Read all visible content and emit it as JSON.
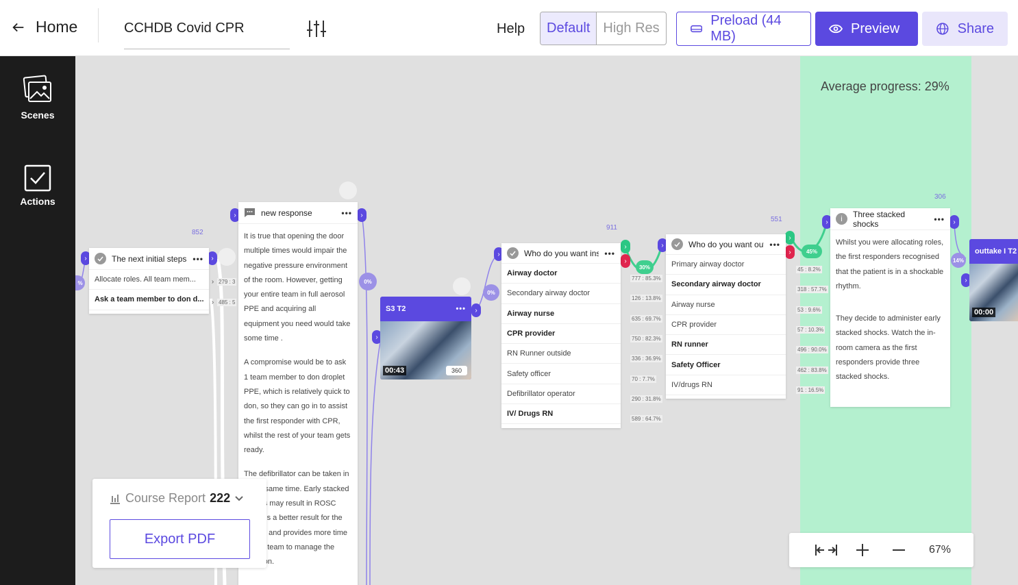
{
  "header": {
    "home_label": "Home",
    "project_title": "CCHDB Covid CPR",
    "help_label": "Help",
    "resolution": {
      "default_label": "Default",
      "high_label": "High Res",
      "selected": "Default"
    },
    "preload_label": "Preload (44 MB)",
    "preview_label": "Preview",
    "share_label": "Share"
  },
  "sidebar": {
    "items": [
      {
        "label": "Scenes",
        "icon": "images-icon"
      },
      {
        "label": "Actions",
        "icon": "checkbox-icon"
      }
    ]
  },
  "canvas": {
    "average_progress": "Average progress: 29%",
    "nodes": {
      "next_steps": {
        "title": "The next initial steps",
        "count": "852",
        "options": [
          "Allocate roles. All team mem...",
          "Ask a team member to don d..."
        ],
        "stats": [
          "279 : 3",
          "485 : 5"
        ],
        "in_pct": "%"
      },
      "new_response": {
        "title": "new response",
        "paragraphs": [
          "It is true that opening the door multiple times would impair the negative pressure environment of the room. However, getting your entire team in full aerosol PPE and acquiring all equipment you need would take some time .",
          "A compromise would be to ask 1 team member to don droplet PPE, which is relatively quick to don, so they can go in to assist the first responder with CPR, whilst the rest of your team gets ready.",
          "The defibrillator can be taken in at the same time. Early stacked shocks may result in ROSC which is a better result for the patient and provides more time for the team to manage the situation."
        ],
        "out_pct": "0%"
      },
      "s3t2": {
        "title": "S3 T2",
        "time": "00:43",
        "badge": "360",
        "in_pct": "0%"
      },
      "inside": {
        "title": "Who do you want inside?",
        "count": "911",
        "options": [
          {
            "label": "Airway doctor",
            "bold": true,
            "stat": "777 : 85.3%"
          },
          {
            "label": "Secondary airway doctor",
            "bold": false,
            "stat": "126 : 13.8%"
          },
          {
            "label": "Airway nurse",
            "bold": true,
            "stat": "635 : 69.7%"
          },
          {
            "label": "CPR provider",
            "bold": true,
            "stat": "750 : 82.3%"
          },
          {
            "label": "RN Runner outside",
            "bold": false,
            "stat": "336 : 36.9%"
          },
          {
            "label": "Safety officer",
            "bold": false,
            "stat": "70 : 7.7%"
          },
          {
            "label": "Defibrillator operator",
            "bold": false,
            "stat": "290 : 31.8%"
          },
          {
            "label": "IV/ Drugs RN",
            "bold": true,
            "stat": "589 : 64.7%"
          }
        ],
        "out_pct": "30%"
      },
      "outside": {
        "title": "Who do you want outside?",
        "count": "551",
        "options": [
          {
            "label": "Primary airway doctor",
            "bold": false,
            "stat": "45 : 8.2%"
          },
          {
            "label": "Secondary airway doctor",
            "bold": true,
            "stat": "318 : 57.7%"
          },
          {
            "label": "Airway nurse",
            "bold": false,
            "stat": "53 : 9.6%"
          },
          {
            "label": "CPR provider",
            "bold": false,
            "stat": "57 : 10.3%"
          },
          {
            "label": "RN runner",
            "bold": true,
            "stat": "496 : 90.0%"
          },
          {
            "label": "Safety Officer",
            "bold": true,
            "stat": "462 : 83.8%"
          },
          {
            "label": "IV/drugs RN",
            "bold": false,
            "stat": "91 : 16.5%"
          }
        ],
        "out_pct": "45%"
      },
      "stacked": {
        "title": "Three stacked shocks",
        "count": "306",
        "paragraphs": [
          "Whilst you were allocating roles, the first responders recognised that the patient is in a shockable rhythm.",
          "They decide to administer early stacked shocks. Watch the in-room camera as the first responders provide three stacked shocks."
        ],
        "out_pct": "14%"
      },
      "outtake": {
        "title": "outtake I T2",
        "time": "00:00"
      }
    }
  },
  "report": {
    "label": "Course Report",
    "count": "222",
    "export_label": "Export PDF"
  },
  "zoom": {
    "level": "67%"
  },
  "colors": {
    "accent": "#5b49e0",
    "green_band": "#b4f0cf",
    "port_green": "#2cc784",
    "port_red": "#e0244e",
    "sidebar": "#1c1c1c"
  }
}
